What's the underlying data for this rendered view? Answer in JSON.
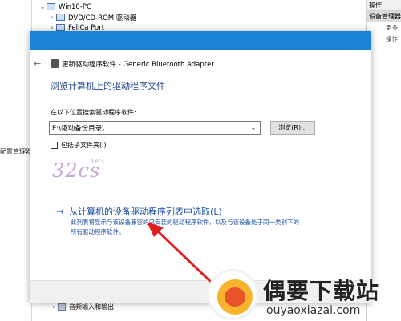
{
  "background": {
    "left_labels": [
      "配置管理器"
    ],
    "tree": {
      "root": "Win10-PC",
      "items": [
        "DVD/CD-ROM 驱动器",
        "FeliCa Port"
      ],
      "bottom_item": "音频输入和输出"
    },
    "actions": {
      "title": "操作",
      "selected": "设备管理器",
      "more": "更多操作"
    }
  },
  "dialog": {
    "title": "更新驱动程序软件 - Generic Bluetooth Adapter",
    "heading": "浏览计算机上的驱动程序文件",
    "search_label": "在以下位置搜索驱动程序软件:",
    "path_value": "E:\\驱动备份目录\\",
    "browse_label": "浏览(R)...",
    "include_subfolders_label": "包括子文件夹(I)",
    "include_subfolders_checked": false,
    "pick_link": "从计算机的设备驱动程序列表中选取(L)",
    "pick_desc_line1": "此列表将显示与该设备兼容的已安装的驱动程序软件，以及与该设备处于同一类别下的",
    "pick_desc_line2": "所有驱动程序软件。"
  },
  "watermark": {
    "text": "32cs",
    "small": "3 PCs"
  },
  "site_logo": {
    "name": "偶要下载站",
    "url": "ouyaoxiazai.com"
  },
  "colors": {
    "accent": "#1883d7",
    "heading": "#1e3f8a",
    "link": "#1e4fa8",
    "annotation_arrow": "#e02020"
  },
  "icons": [
    "back-arrow-icon",
    "bluetooth-device-icon",
    "chevron-down-icon",
    "right-arrow-icon",
    "expand-arrow-icon",
    "computer-icon"
  ]
}
